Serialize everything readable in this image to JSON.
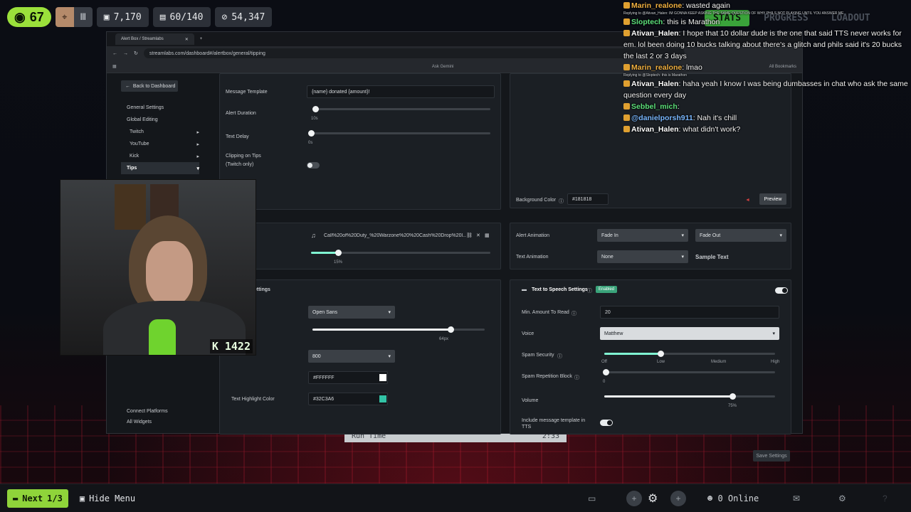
{
  "hud": {
    "level": "67",
    "stat1": "7,170",
    "stat2": "60/140",
    "stat3": "54,347",
    "tabs": [
      "STATS",
      "PROGRESS",
      "LOADOUT"
    ]
  },
  "browser": {
    "tab_title": "Alert Box / Streamlabs",
    "url": "streamlabs.com/dashboard#/alertbox/general/tipping",
    "bookmark_left": "Ask Gemini",
    "bookmark_right": "All Bookmarks"
  },
  "sidebar": {
    "back_label": "Back to Dashboard",
    "items": [
      "General Settings",
      "Global Editing",
      "Twitch",
      "YouTube",
      "Kick",
      "Tips"
    ],
    "footer": [
      "Connect Platforms",
      "All Widgets"
    ]
  },
  "left_panel": {
    "message_template_label": "Message Template",
    "message_template_value": "{name} donated {amount}!",
    "alert_duration_label": "Alert Duration",
    "alert_duration_value": "10s",
    "text_delay_label": "Text Delay",
    "text_delay_value": "0s",
    "clipping_label": "Clipping on Tips",
    "clipping_sub": "(Twitch only)"
  },
  "sound_panel": {
    "file": "Call%20of%20Duty_%20Warzone%20%20Cash%20Drop%20l...",
    "volume_value": "15%",
    "volume": 0.15
  },
  "font_panel": {
    "title": "ettings",
    "font": "Open Sans",
    "size_value": "64px",
    "size": 0.8,
    "weight": "800",
    "text_color": "#FFFFFF",
    "highlight_label": "Text Highlight Color",
    "highlight_color": "#32C3A6"
  },
  "right_top": {
    "bg_color_label": "Background Color",
    "bg_color_value": "#181818",
    "preview_label": "Preview",
    "alert_animation_label": "Alert Animation",
    "anim_in": "Fade In",
    "anim_out": "Fade Out",
    "text_animation_label": "Text Animation",
    "text_anim": "None",
    "sample_text": "Sample Text"
  },
  "tts": {
    "title": "Text to Speech Settings",
    "enabled": "Enabled",
    "min_amount_label": "Min. Amount To Read",
    "min_amount": "20",
    "voice_label": "Voice",
    "voice": "Matthew",
    "spam_security_label": "Spam Security",
    "spam_levels": [
      "Off",
      "Low",
      "Medium",
      "High"
    ],
    "spam_level": 0.33,
    "repetition_label": "Spam Repetition Block",
    "repetition_value": "0",
    "volume_label": "Volume",
    "volume_value": "75%",
    "volume": 0.75,
    "include_label": "Include message template in",
    "include_label2": "TTS",
    "save_label": "Save Settings"
  },
  "chat": [
    {
      "reply": "",
      "name": "Marin_realone",
      "color": "#f0b040",
      "text": "wasted again"
    },
    {
      "reply": "Replying to @Ativan_Halen: IM GONNA KEEP ASKING THE SAME QUESTION OF WHY PHILS NOT PLAYING UNTIL YOU ANSWER ME",
      "name": "Sloptech",
      "color": "#5ce07a",
      "text": "this is Marathon"
    },
    {
      "reply": "",
      "name": "Ativan_Halen",
      "color": "#ffffff",
      "text": "I hope that 10 dollar dude is the one that said TTS never works for em. lol been doing 10 bucks talking about there's a glitch and phils said it's 20 bucks the last 2 or 3 days"
    },
    {
      "reply": "",
      "name": "Marin_realone",
      "color": "#f0b040",
      "text": "lmao"
    },
    {
      "reply": "Replying to @Sloptech: this is Marathon",
      "name": "Ativan_Halen",
      "color": "#ffffff",
      "text": "haha yeah I know I was being dumbasses in chat who ask the same question every day"
    },
    {
      "reply": "",
      "name": "Sebbel_mich",
      "color": "#5ce07a",
      "text": ""
    },
    {
      "reply": "",
      "name": "@danielporsh911",
      "color": "#7ab8ff",
      "text": "Nah it's chill"
    },
    {
      "reply": "",
      "name": "Ativan_Halen",
      "color": "#ffffff",
      "text": "what didn't work?"
    }
  ],
  "webcam": {
    "tag": "1422"
  },
  "runtime": {
    "label": "Run Time",
    "value": "2:33"
  },
  "bottom": {
    "next_label": "Next",
    "next_count": "1/3",
    "hide_menu": "Hide Menu",
    "online": "0 Online"
  }
}
